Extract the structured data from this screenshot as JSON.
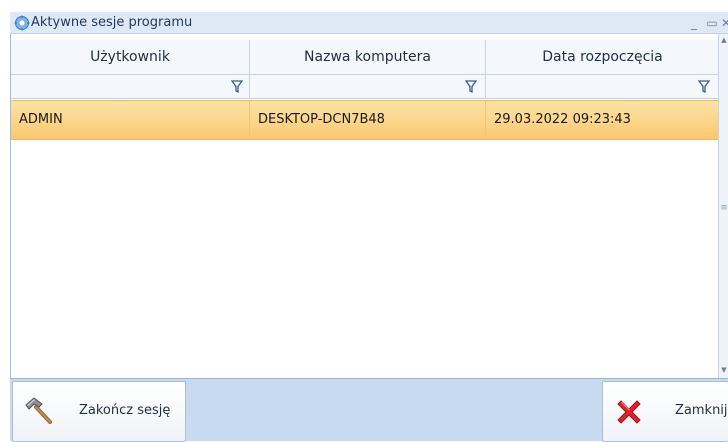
{
  "window": {
    "title": "Aktywne sesje programu",
    "minimize_glyph": "_",
    "maximize_glyph": "▭",
    "close_glyph": "✕",
    "app_icon": "gear-icon"
  },
  "grid": {
    "columns": [
      "Użytkownik",
      "Nazwa komputera",
      "Data rozpoczęcia"
    ],
    "filter_icon": "funnel-icon",
    "rows": [
      {
        "user": "ADMIN",
        "computer": "DESKTOP-DCN7B48",
        "started": "29.03.2022 09:23:43",
        "selected": true
      }
    ]
  },
  "buttons": {
    "end_session": {
      "label": "Zakończ sesję",
      "icon": "hammer-icon"
    },
    "close": {
      "label": "Zamknij",
      "icon": "close-x-icon"
    }
  },
  "colors": {
    "selected_row": "#fbc96e",
    "title_bar": "#dfe9f5",
    "bottom_bar": "#c8daf0",
    "close_icon_red": "#d9252a"
  }
}
